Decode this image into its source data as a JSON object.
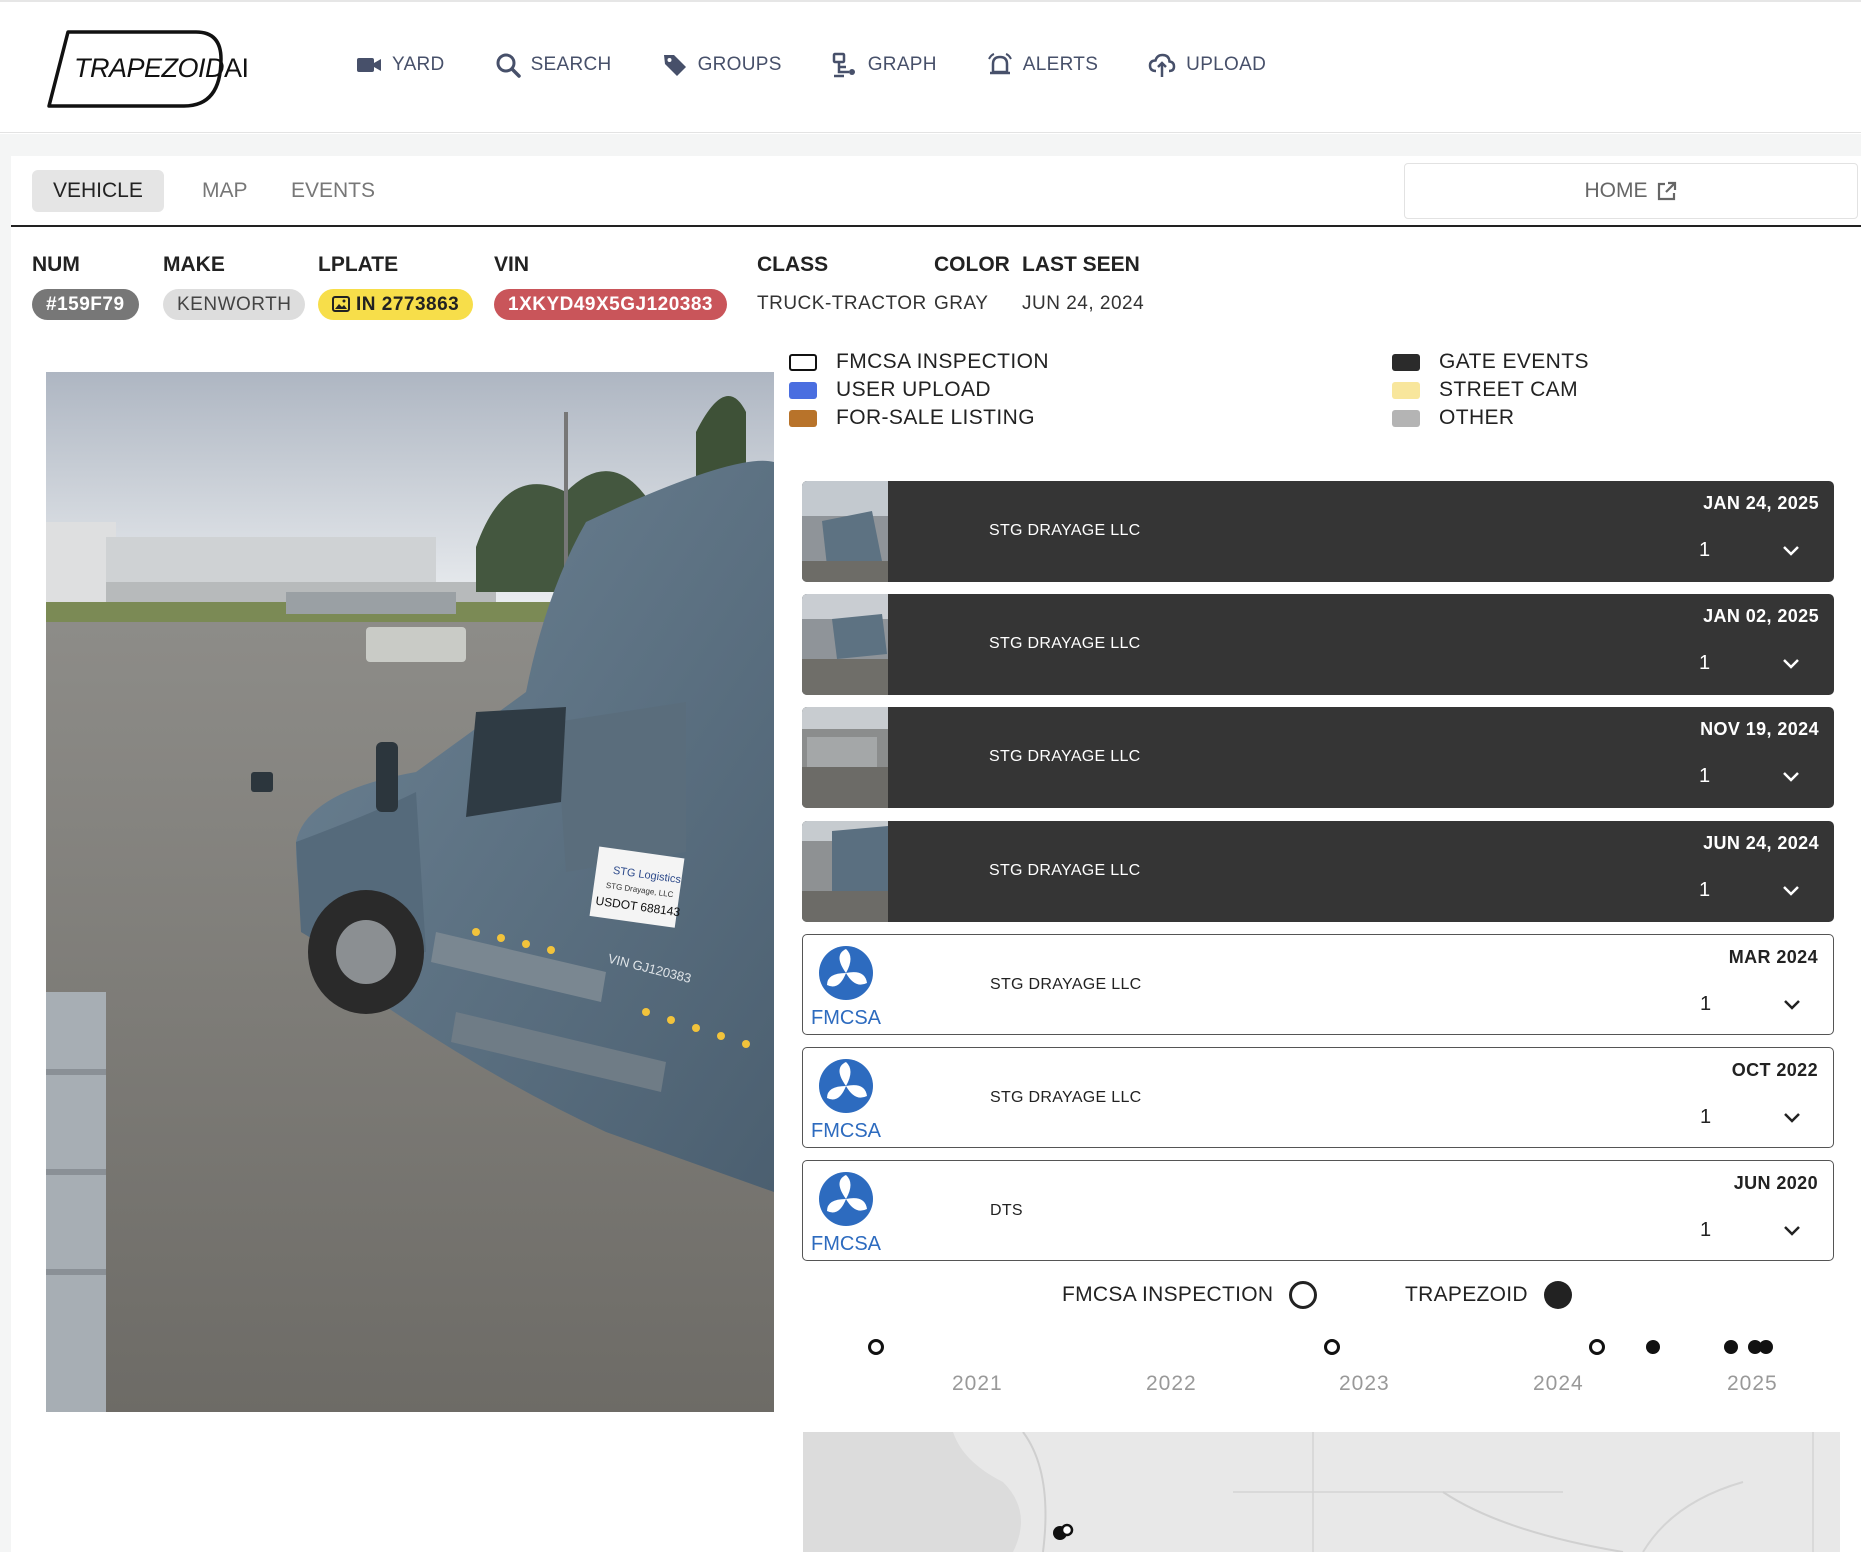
{
  "app": {
    "logo_main": "TRAPEZOID",
    "logo_suffix": "AI"
  },
  "nav": [
    {
      "label": "YARD",
      "icon": "video-camera-icon"
    },
    {
      "label": "SEARCH",
      "icon": "search-icon"
    },
    {
      "label": "GROUPS",
      "icon": "tag-icon"
    },
    {
      "label": "GRAPH",
      "icon": "graph-icon"
    },
    {
      "label": "ALERTS",
      "icon": "alarm-icon"
    },
    {
      "label": "UPLOAD",
      "icon": "cloud-upload-icon"
    }
  ],
  "tabs": {
    "vehicle": "VEHICLE",
    "map": "MAP",
    "events": "EVENTS",
    "active": "VEHICLE",
    "home_label": "HOME"
  },
  "vehicle": {
    "num": {
      "label": "NUM",
      "value": "#159F79"
    },
    "make": {
      "label": "MAKE",
      "value": "KENWORTH"
    },
    "lplate": {
      "label": "LPLATE",
      "value": "IN 2773863"
    },
    "vin": {
      "label": "VIN",
      "value": "1XKYD49X5GJ120383"
    },
    "class": {
      "label": "CLASS",
      "value": "TRUCK-TRACTOR"
    },
    "color": {
      "label": "COLOR",
      "value": "GRAY"
    },
    "last_seen": {
      "label": "LAST SEEN",
      "value": "JUN 24, 2024"
    }
  },
  "legend": [
    {
      "label": "FMCSA INSPECTION",
      "color": "#ffffff",
      "border": "#111111"
    },
    {
      "label": "USER UPLOAD",
      "color": "#4a6ee0"
    },
    {
      "label": "FOR-SALE LISTING",
      "color": "#b8732a"
    },
    {
      "label": "GATE EVENTS",
      "color": "#2b2b2b"
    },
    {
      "label": "STREET CAM",
      "color": "#f8e69c"
    },
    {
      "label": "OTHER",
      "color": "#b4b4b4"
    }
  ],
  "events": [
    {
      "date": "JAN 24, 2025",
      "company": "STG DRAYAGE LLC",
      "count": "1",
      "type": "gate"
    },
    {
      "date": "JAN 02, 2025",
      "company": "STG DRAYAGE LLC",
      "count": "1",
      "type": "gate"
    },
    {
      "date": "NOV 19, 2024",
      "company": "STG DRAYAGE LLC",
      "count": "1",
      "type": "gate"
    },
    {
      "date": "JUN 24, 2024",
      "company": "STG DRAYAGE LLC",
      "count": "1",
      "type": "gate"
    },
    {
      "date": "MAR 2024",
      "company": "STG DRAYAGE LLC",
      "count": "1",
      "type": "fmcsa",
      "logo_text": "FMCSA"
    },
    {
      "date": "OCT 2022",
      "company": "STG DRAYAGE LLC",
      "count": "1",
      "type": "fmcsa",
      "logo_text": "FMCSA"
    },
    {
      "date": "JUN 2020",
      "company": "DTS",
      "count": "1",
      "type": "fmcsa",
      "logo_text": "FMCSA"
    }
  ],
  "timeline": {
    "legend_fmcsa": "FMCSA INSPECTION",
    "legend_trapezoid": "TRAPEZOID",
    "years": [
      "2021",
      "2022",
      "2023",
      "2024",
      "2025"
    ]
  },
  "photo": {
    "decal_company": "STG Logistics",
    "decal_operator": "STG Drayage, LLC",
    "decal_usdot": "USDOT 688143",
    "decal_vin": "VIN GJ120383"
  }
}
